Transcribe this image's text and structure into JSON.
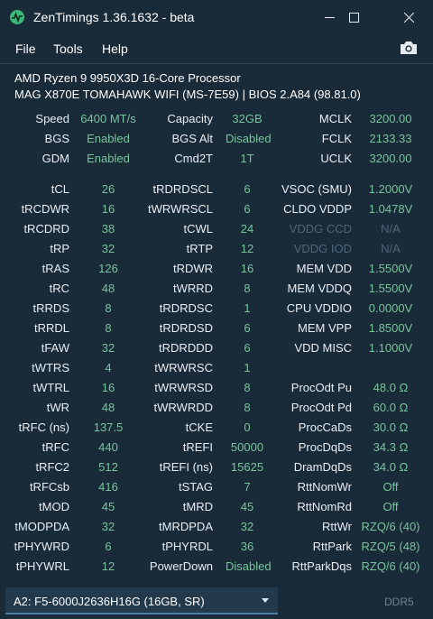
{
  "window": {
    "title": "ZenTimings 1.36.1632 - beta",
    "minimize_icon": "minimize-icon",
    "maximize_icon": "maximize-icon",
    "close_icon": "close-icon"
  },
  "menu": {
    "file": "File",
    "tools": "Tools",
    "help": "Help",
    "screenshot_icon": "camera-icon"
  },
  "system": {
    "cpu": "AMD Ryzen 9 9950X3D 16-Core Processor",
    "board": "MAG X870E TOMAHAWK WIFI (MS-7E59) | BIOS 2.A84 (98.81.0)"
  },
  "summary": [
    [
      "Speed",
      "6400 MT/s",
      "Capacity",
      "32GB",
      "MCLK",
      "3200.00"
    ],
    [
      "BGS",
      "Enabled",
      "BGS Alt",
      "Disabled",
      "FCLK",
      "2133.33"
    ],
    [
      "GDM",
      "Enabled",
      "Cmd2T",
      "1T",
      "UCLK",
      "3200.00"
    ]
  ],
  "timings": [
    [
      "tCL",
      "26",
      "tRDRDSCL",
      "6",
      "VSOC (SMU)",
      "1.2000V"
    ],
    [
      "tRCDWR",
      "16",
      "tWRWRSCL",
      "6",
      "CLDO VDDP",
      "1.0478V"
    ],
    [
      "tRCDRD",
      "38",
      "tCWL",
      "24",
      "VDDG CCD",
      "N/A"
    ],
    [
      "tRP",
      "32",
      "tRTP",
      "12",
      "VDDG IOD",
      "N/A"
    ],
    [
      "tRAS",
      "126",
      "tRDWR",
      "16",
      "MEM VDD",
      "1.5500V"
    ],
    [
      "tRC",
      "48",
      "tWRRD",
      "8",
      "MEM VDDQ",
      "1.5500V"
    ],
    [
      "tRRDS",
      "8",
      "tRDRDSC",
      "1",
      "CPU VDDIO",
      "0.0000V"
    ],
    [
      "tRRDL",
      "8",
      "tRDRDSD",
      "6",
      "MEM VPP",
      "1.8500V"
    ],
    [
      "tFAW",
      "32",
      "tRDRDDD",
      "6",
      "VDD MISC",
      "1.1000V"
    ],
    [
      "tWTRS",
      "4",
      "tWRWRSC",
      "1",
      "",
      ""
    ],
    [
      "tWTRL",
      "16",
      "tWRWRSD",
      "8",
      "ProcOdt Pu",
      "48.0 Ω"
    ],
    [
      "tWR",
      "48",
      "tWRWRDD",
      "8",
      "ProcOdt Pd",
      "60.0 Ω"
    ],
    [
      "tRFC (ns)",
      "137.5",
      "tCKE",
      "0",
      "ProcCaDs",
      "30.0 Ω"
    ],
    [
      "tRFC",
      "440",
      "tREFI",
      "50000",
      "ProcDqDs",
      "34.3 Ω"
    ],
    [
      "tRFC2",
      "512",
      "tREFI (ns)",
      "15625",
      "DramDqDs",
      "34.0 Ω"
    ],
    [
      "tRFCsb",
      "416",
      "tSTAG",
      "7",
      "RttNomWr",
      "Off"
    ],
    [
      "tMOD",
      "45",
      "tMRD",
      "45",
      "RttNomRd",
      "Off"
    ],
    [
      "tMODPDA",
      "32",
      "tMRDPDA",
      "32",
      "RttWr",
      "RZQ/6 (40)"
    ],
    [
      "tPHYWRD",
      "6",
      "tPHYRDL",
      "36",
      "RttPark",
      "RZQ/5 (48)"
    ],
    [
      "tPHYWRL",
      "12",
      "PowerDown",
      "Disabled",
      "RttParkDqs",
      "RZQ/6 (40)"
    ]
  ],
  "module_select": {
    "value": "A2: F5-6000J2636H16G (16GB, SR)",
    "type": "DDR5"
  },
  "colors": {
    "background": "#192a38",
    "value": "#78c59c",
    "disabled": "#4f6578",
    "accent": "#4a7fa6"
  }
}
